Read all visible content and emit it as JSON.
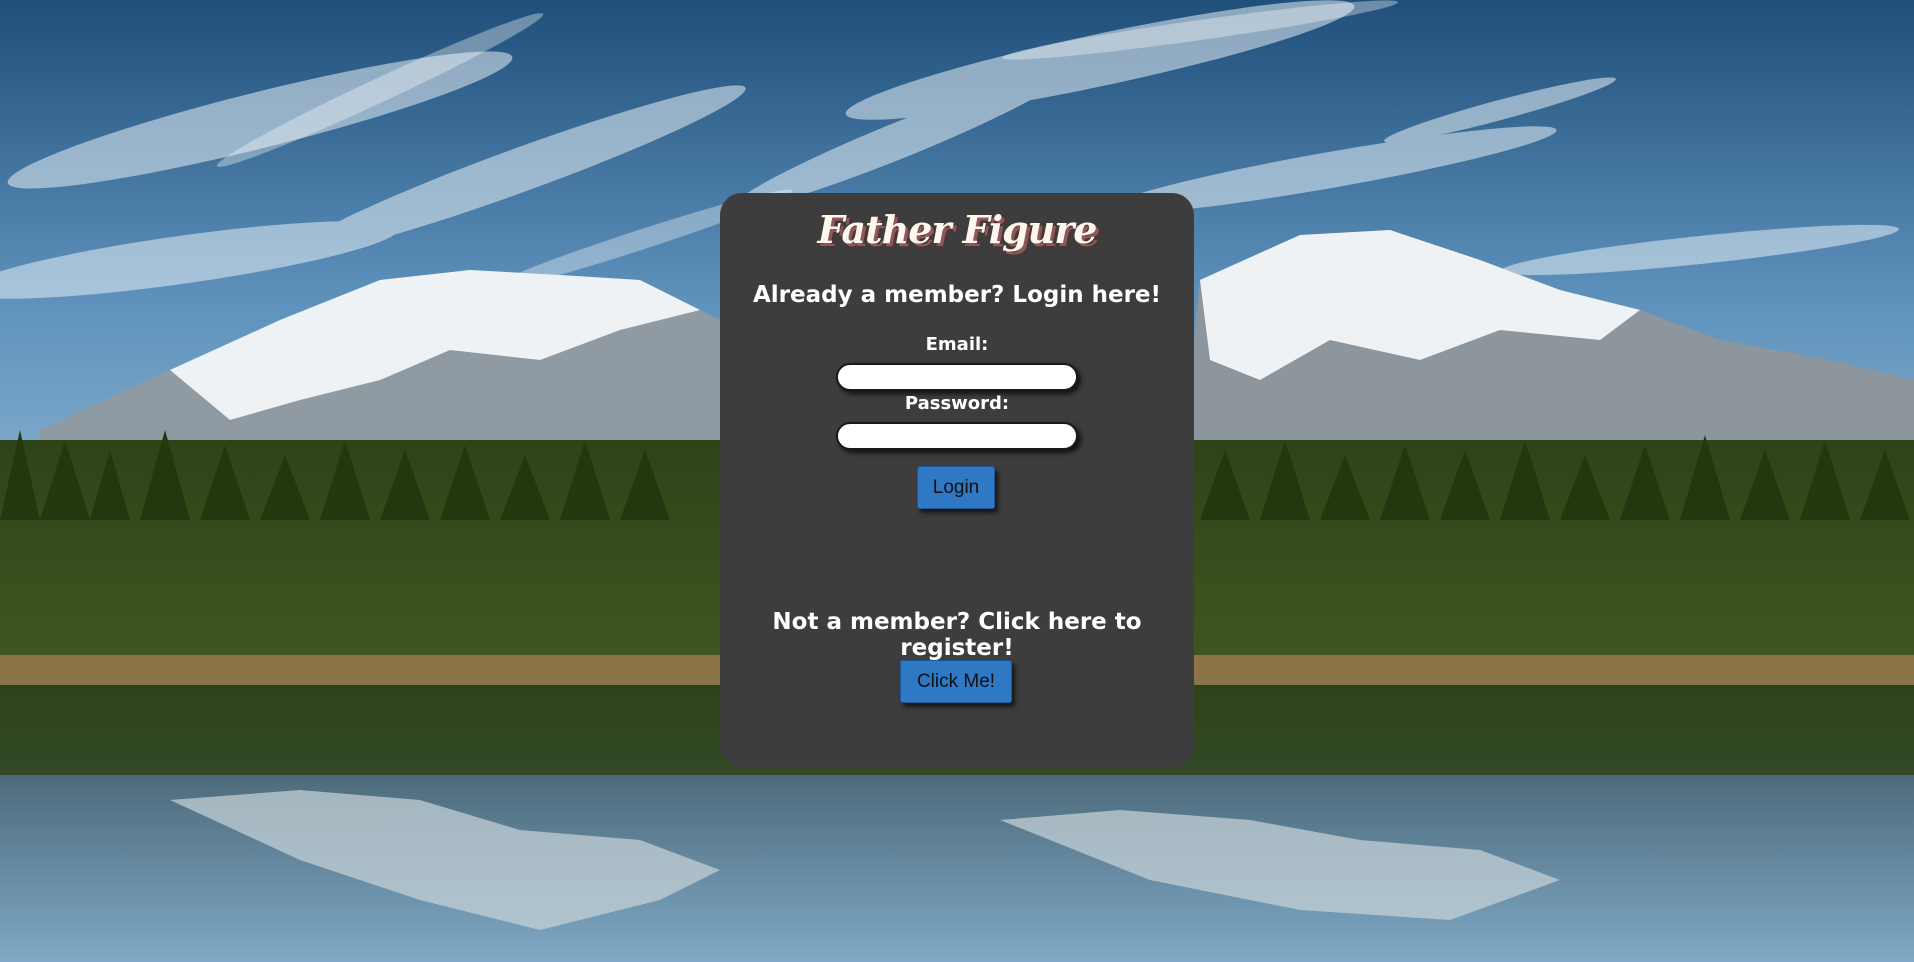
{
  "app": {
    "brand": "Father Figure"
  },
  "login": {
    "heading": "Already a member? Login here!",
    "email_label": "Email:",
    "email_value": "",
    "password_label": "Password:",
    "password_value": "",
    "button_label": "Login"
  },
  "register": {
    "heading": "Not a member? Click here to register!",
    "button_label": "Click Me!"
  },
  "colors": {
    "card_background": "#3d3d3d",
    "button_accent": "#2f78c4",
    "brand_shadow": "#8a5a5a"
  }
}
